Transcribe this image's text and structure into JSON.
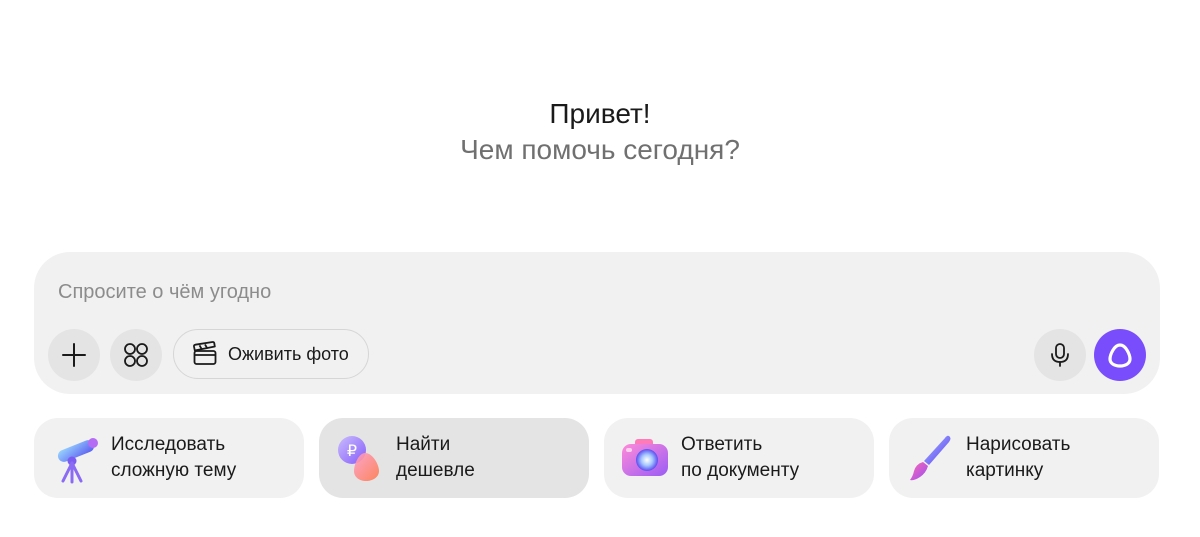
{
  "greeting": {
    "title": "Привет!",
    "subtitle": "Чем помочь сегодня?"
  },
  "composer": {
    "placeholder": "Спросите о чём угодно",
    "value": "",
    "add_icon": "plus-icon",
    "apps_icon": "grid-dots-icon",
    "animate_photo_label": "Оживить фото",
    "animate_photo_icon": "clapperboard-icon",
    "mic_icon": "microphone-icon",
    "alice_icon": "alice-ring-icon"
  },
  "suggestions": [
    {
      "line1": "Исследовать",
      "line2": "сложную тему",
      "icon": "telescope-icon"
    },
    {
      "line1": "Найти",
      "line2": "дешевле",
      "icon": "price-tag-icon"
    },
    {
      "line1": "Ответить",
      "line2": "по документу",
      "icon": "camera-icon"
    },
    {
      "line1": "Нарисовать",
      "line2": "картинку",
      "icon": "paintbrush-icon"
    }
  ],
  "colors": {
    "accent": "#7a4dfc",
    "surface": "#f1f1f1",
    "surface_hover": "#e4e4e4",
    "muted_text": "#707070"
  }
}
